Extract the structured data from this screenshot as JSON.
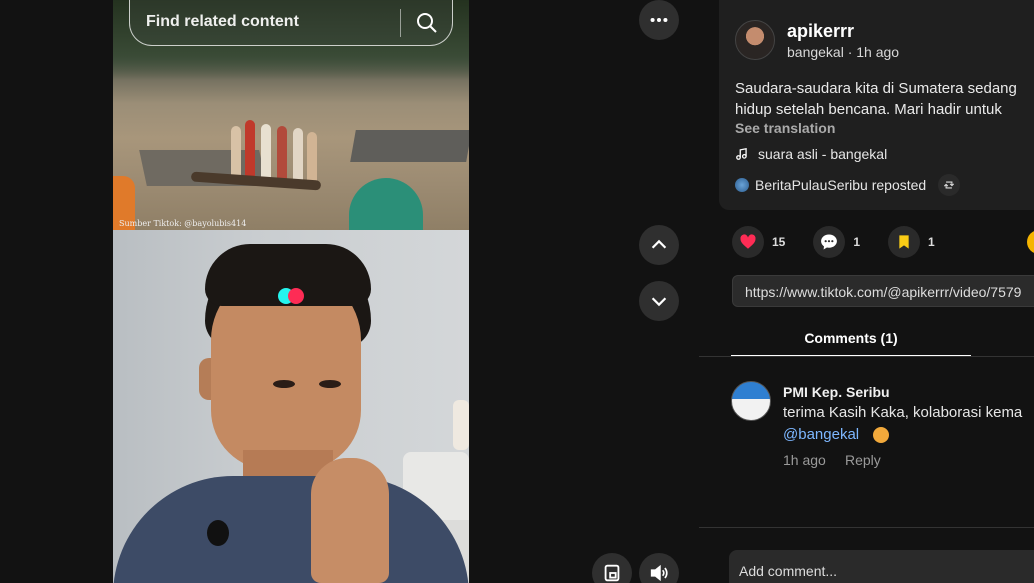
{
  "search": {
    "placeholder": "Find related content"
  },
  "video": {
    "source_caption": "Sumber Tiktok: @bayolubis414"
  },
  "post": {
    "username": "apikerrr",
    "subline": "bangekal · 1h ago",
    "description_line1": "Saudara-saudara kita di Sumatera sedang",
    "description_line2": "hidup setelah bencana. Mari hadir untuk",
    "see_translation": "See translation",
    "music": "suara asli - bangekal",
    "repost": "BeritaPulauSeribu reposted"
  },
  "actions": {
    "likes": "15",
    "comments": "1",
    "favorites": "1",
    "like_color": "#fe2c55",
    "favorite_color": "#facc15"
  },
  "url": "https://www.tiktok.com/@apikerrr/video/7579",
  "tabs": {
    "comments": "Comments (1)"
  },
  "comment": {
    "author": "PMI Kep. Seribu",
    "text": "terima Kasih Kaka, kolaborasi kema",
    "mention": "@bangekal",
    "time": "1h ago",
    "reply": "Reply"
  },
  "composer": {
    "placeholder": "Add comment..."
  },
  "icons": {
    "more": "more-icon",
    "up": "chevron-up-icon",
    "down": "chevron-down-icon",
    "pip": "picture-in-picture-icon",
    "volume": "volume-icon"
  }
}
